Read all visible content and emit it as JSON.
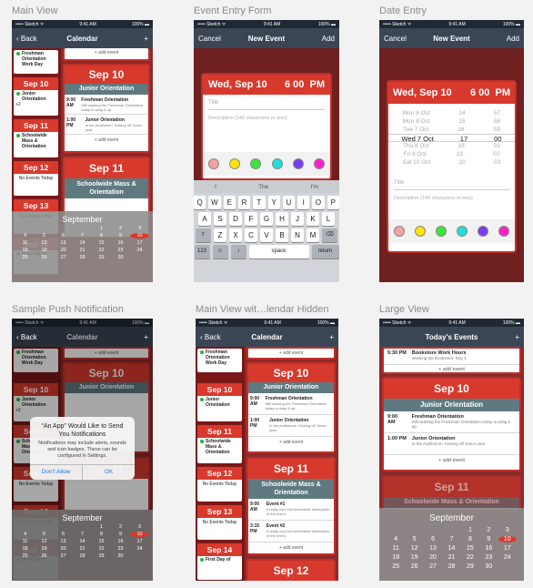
{
  "labels": {
    "main_view": "Main View",
    "event_entry": "Event Entry Form",
    "date_entry": "Date Entry",
    "push": "Sample Push Notification",
    "main_hidden": "Main View wit…lendar Hidden",
    "large": "Large View"
  },
  "status": {
    "carrier": "••••• Sketch ᯤ",
    "time": "9:41 AM",
    "battery": "100% ▬"
  },
  "nav": {
    "back": "Back",
    "calendar": "Calendar",
    "plus": "+",
    "cancel": "Cancel",
    "new_event": "New Event",
    "add": "Add",
    "todays_events": "Today's Events"
  },
  "rail": {
    "e1": "Freshman Orientation Work Day",
    "sep10": "Sep 10",
    "e2": "Junior Orientation",
    "more": "+2",
    "sep11": "Sep 11",
    "e3": "Schoolwide Mass & Orientation",
    "sep12": "Sep 12",
    "no": "No Events Today",
    "sep13": "Sep 13",
    "sep14": "Sep 14",
    "e4": "First Day of"
  },
  "main": {
    "add_event": "+ add event",
    "sep10": "Sep 10",
    "junior": "Junior Orientation",
    "t1": "9:00 AM",
    "n1": "Freshman Orientation",
    "d1": "Still working the Freshman Orientation today to wrap it up.",
    "t2": "1:00 PM",
    "n2": "Junior Orientation",
    "d2": "In the Auditorium. Kicking off Junior year.",
    "sep11": "Sep 11",
    "mass": "Schoolwide Mass & Orientation",
    "t3": "9:00 AM",
    "n3": "Event #1",
    "d3": "A really cool but informative description of the event.",
    "t4": "3:15 PM",
    "n4": "Event #2",
    "d4": "A really cool but informative description of the event.",
    "n5": "Event #3",
    "sep12": "Sep 12",
    "t0": "5:30 PM",
    "n0": "Bookstore Work Hours",
    "d0": "Working the Bookstore. Day 4."
  },
  "calendar": {
    "month": "September",
    "days": [
      "",
      "",
      "",
      "",
      "1",
      "2",
      "3",
      "4",
      "5",
      "6",
      "7",
      "8",
      "9",
      "10",
      "11",
      "12",
      "13",
      "14",
      "15",
      "16",
      "17",
      "18",
      "19",
      "20",
      "21",
      "22",
      "23",
      "24",
      "25",
      "26",
      "27",
      "28",
      "29",
      "30"
    ],
    "today": "10"
  },
  "form": {
    "date": "Wed, Sep 10",
    "hour": "6",
    "minute": "00",
    "ampm": "PM",
    "title_ph": "Title",
    "desc_ph": "Description (140 characters or less)",
    "swatches": [
      "#f4a3a3",
      "#ffe600",
      "#39e639",
      "#1ee0d8",
      "#7a3cf0",
      "#ff1fc8"
    ]
  },
  "keyboard": {
    "sugg": [
      "I",
      "The",
      "I'm"
    ],
    "row1": [
      "Q",
      "W",
      "E",
      "R",
      "T",
      "Y",
      "U",
      "I",
      "O",
      "P"
    ],
    "row2": [
      "A",
      "S",
      "D",
      "F",
      "G",
      "H",
      "J",
      "K",
      "L"
    ],
    "row3": [
      "Z",
      "X",
      "C",
      "V",
      "B",
      "N",
      "M"
    ],
    "num": "123",
    "emoji": "☺",
    "mic": "🎤",
    "space": "space",
    "return": "return"
  },
  "picker": {
    "rows": [
      {
        "d": "Mon 6 Oct",
        "h": "14",
        "m": "57"
      },
      {
        "d": "Mon 8 Oct",
        "h": "15",
        "m": "58"
      },
      {
        "d": "Tue 7 Oct",
        "h": "16",
        "m": "59"
      },
      {
        "d": "Wed 7 Oct",
        "h": "17",
        "m": "00"
      },
      {
        "d": "Thu 8 Oct",
        "h": "18",
        "m": "01"
      },
      {
        "d": "Fri 9 Oct",
        "h": "19",
        "m": "02"
      },
      {
        "d": "Sat 10 Oct",
        "h": "20",
        "m": "03"
      }
    ],
    "date_header": "Wed, Sep 10",
    "time_header": "6  00  PM"
  },
  "alert": {
    "title": "“An App” Would Like to Send You Notifications",
    "body": "Notifications may include alerts, sounds and icon badges. These can be configured in Settings.",
    "deny": "Don't Allow",
    "ok": "OK"
  }
}
